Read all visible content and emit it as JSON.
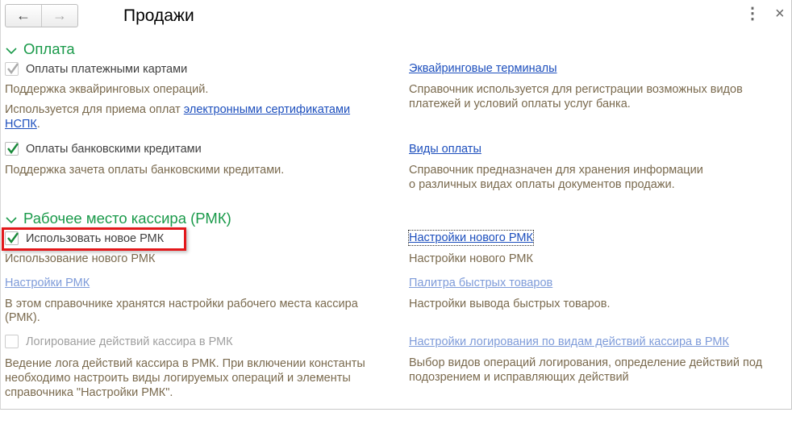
{
  "header": {
    "title": "Продажи",
    "back_label": "←",
    "forward_label": "→",
    "more_icon": "more-vertical-icon",
    "close_icon": "close-icon",
    "more_label": "⋮",
    "close_label": "×"
  },
  "sections": [
    {
      "title": "Оплата",
      "left": {
        "cards": {
          "label": "Оплаты платежными картами",
          "checked": true,
          "disabled": true,
          "desc": "Поддержка эквайринговых операций.",
          "usage_prefix": "Используется для приема оплат ",
          "usage_link_1": "электронными сертификатами",
          "usage_link_2": "НСПК",
          "usage_suffix": "."
        },
        "credits": {
          "label": "Оплаты банковскими кредитами",
          "checked": true,
          "desc": "Поддержка зачета оплаты банковскими кредитами."
        }
      },
      "right": {
        "terminals": {
          "link": "Эквайринговые терминалы",
          "desc_1": "Справочник используется для регистрации возможных видов",
          "desc_2": "платежей и условий оплаты услуг банка."
        },
        "payment_types": {
          "link": "Виды оплаты",
          "desc_1": "Справочник предназначен для хранения информации",
          "desc_2": "о различных видах оплаты документов продажи."
        }
      }
    },
    {
      "title": "Рабочее место кассира (РМК)",
      "left": {
        "new_rmk": {
          "label": "Использовать новое РМК",
          "checked": true,
          "desc": "Использование нового РМК"
        },
        "rmk_settings": {
          "link": "Настройки РМК",
          "desc_1": "В этом справочнике хранятся настройки рабочего места кассира",
          "desc_2": "(РМК)."
        },
        "logging": {
          "label": "Логирование действий кассира в РМК",
          "checked": false,
          "disabled": true,
          "desc_1": "Ведение лога действий кассира в РМК. При включении константы",
          "desc_2": "необходимо настроить виды логируемых операций и элементы",
          "desc_3": "справочника \"Настройки РМК\"."
        }
      },
      "right": {
        "new_rmk_settings": {
          "link": "Настройки нового РМК",
          "desc": "Настройки нового РМК"
        },
        "palette": {
          "link": "Палитра быстрых товаров",
          "desc": "Настройки вывода быстрых товаров."
        },
        "log_settings": {
          "link": "Настройки логирования по видам действий кассира в РМК",
          "desc_1": "Выбор видов операций логирования, определение действий под",
          "desc_2": "подозрением и исправляющих действий"
        }
      }
    }
  ],
  "colors": {
    "section": "#1a9a4a",
    "link": "#1d4fbd",
    "desc": "#7a6a4e",
    "highlight": "#e3181b"
  }
}
